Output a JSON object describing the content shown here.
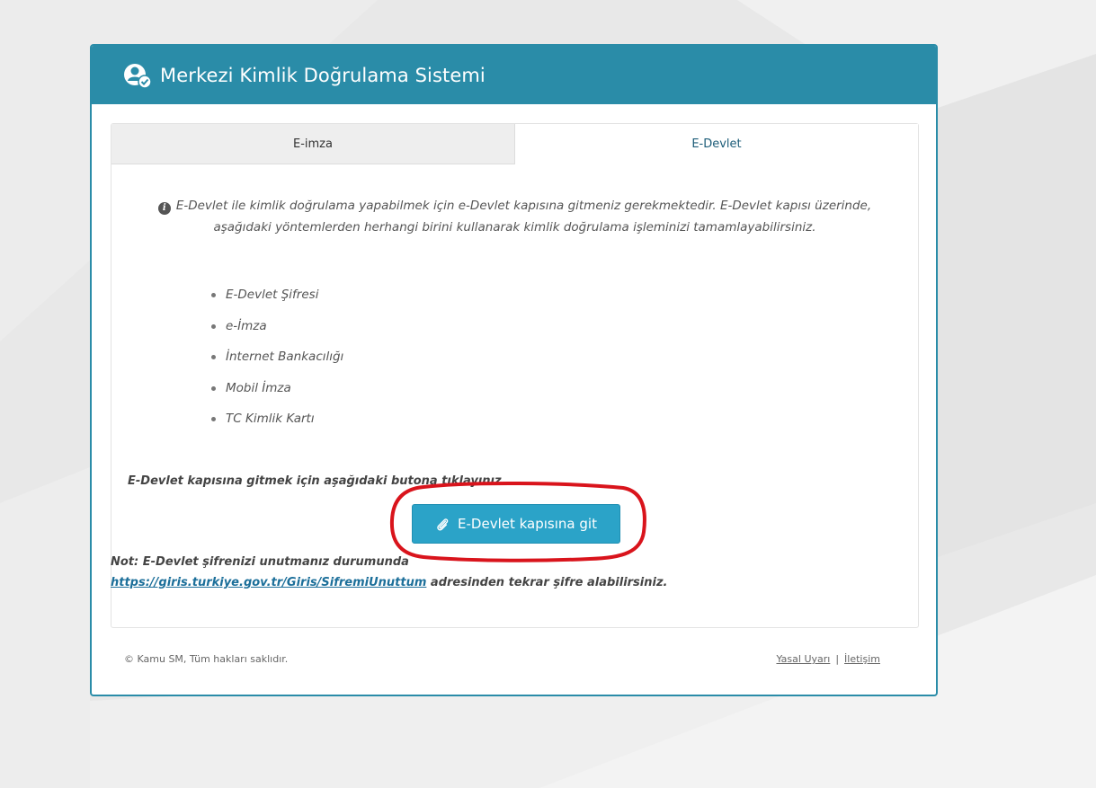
{
  "header": {
    "title": "Merkezi Kimlik Doğrulama Sistemi",
    "icon": "user-verified-icon"
  },
  "tabs": [
    {
      "label": "E-imza",
      "active": false
    },
    {
      "label": "E-Devlet",
      "active": true
    }
  ],
  "info": {
    "icon": "info-icon",
    "text": "E-Devlet ile kimlik doğrulama yapabilmek için e-Devlet kapısına gitmeniz gerekmektedir. E-Devlet kapısı üzerinde, aşağıdaki yöntemlerden herhangi birini kullanarak kimlik doğrulama işleminizi tamamlayabilirsiniz."
  },
  "methods": [
    "E-Devlet Şifresi",
    "e-İmza",
    "İnternet Bankacılığı",
    "Mobil İmza",
    "TC Kimlik Kartı"
  ],
  "instruction": "E-Devlet kapısına gitmek için aşağıdaki butona tıklayınız.",
  "button": {
    "label": "E-Devlet kapısına git",
    "icon": "link-icon"
  },
  "note": {
    "prefix": "Not: E-Devlet şifrenizi unutmanız durumunda",
    "link": "https://giris.turkiye.gov.tr/Giris/SifremiUnuttum",
    "suffix": " adresinden tekrar şifre alabilirsiniz."
  },
  "footer": {
    "copyright": "© Kamu SM, Tüm hakları saklıdır.",
    "legal_link": "Yasal Uyarı",
    "separator": "|",
    "contact_link": "İletişim"
  },
  "colors": {
    "header": "#2a8ca8",
    "button": "#2ba3c8",
    "highlight": "#d9141c"
  }
}
